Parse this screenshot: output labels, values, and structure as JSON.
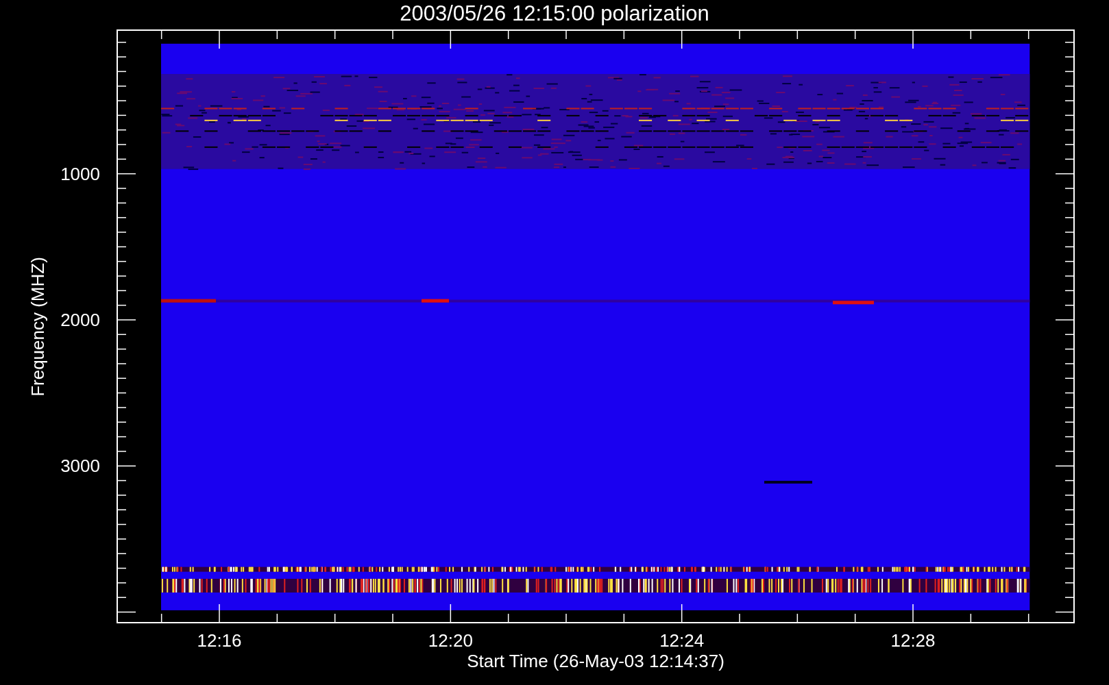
{
  "title": "2003/05/26 12:15:00 polarization",
  "y_axis": {
    "label": "Frequency (MHZ)",
    "ticks": [
      "1000",
      "2000",
      "3000"
    ]
  },
  "x_axis": {
    "label": "Start Time (26-May-03 12:14:37)",
    "ticks": [
      "12:16",
      "12:20",
      "12:24",
      "12:28"
    ]
  }
}
